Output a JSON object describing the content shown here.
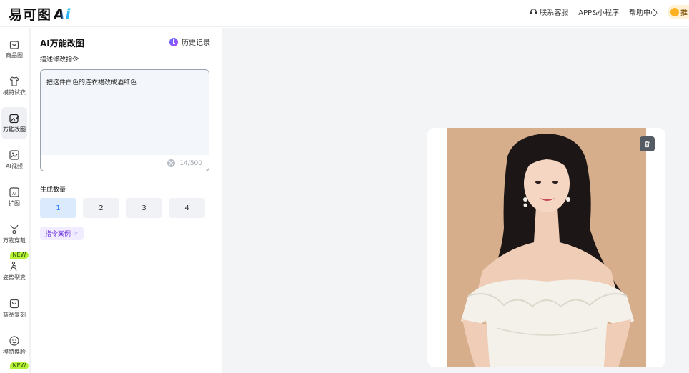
{
  "brand": {
    "logo_text": "易可图",
    "logo_ai": "Ai"
  },
  "topnav": {
    "support": "联系客服",
    "app": "APP&小程序",
    "help": "帮助中心",
    "vip_text": "推"
  },
  "sidebar": {
    "items": [
      {
        "label": "商品图",
        "icon": "bag-icon"
      },
      {
        "label": "模特试衣",
        "icon": "shirt-icon"
      },
      {
        "label": "万能改图",
        "icon": "edit-image-icon",
        "active": true
      },
      {
        "label": "AI视频",
        "icon": "video-icon"
      },
      {
        "label": "扩图",
        "icon": "expand-icon"
      },
      {
        "label": "万物穿戴",
        "icon": "necklace-icon"
      },
      {
        "label": "姿势裂变",
        "icon": "pose-icon"
      },
      {
        "label": "商品复刻",
        "icon": "copy-product-icon"
      },
      {
        "label": "模特换脸",
        "icon": "face-icon"
      }
    ],
    "new_badge": "NEW"
  },
  "panel": {
    "title": "AI万能改图",
    "history": "历史记录",
    "prompt_label": "描述修改指令",
    "prompt_value": "把这件白色的连衣裙改成酒红色",
    "counter": "14/500",
    "qty_label": "生成数量",
    "qty_options": [
      "1",
      "2",
      "3",
      "4"
    ],
    "qty_selected": "1",
    "example_button": "指令案例"
  },
  "colors": {
    "accent": "#1f6fff",
    "photo_bg": "#d7b08e",
    "new_badge": "#b6f23a"
  }
}
